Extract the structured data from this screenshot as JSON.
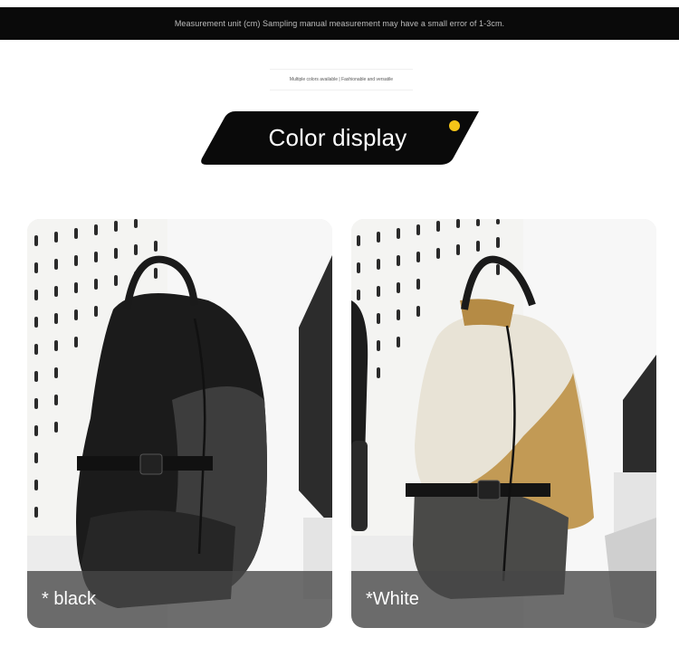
{
  "header": {
    "measurement_note": "Measurement unit (cm) Sampling manual measurement may have a small error of 1-3cm."
  },
  "tagline": "Multiple colors available | Fashionable and versatile",
  "section": {
    "title": "Color display",
    "banner_color": "#0a0a0a",
    "dot_color": "#f5c518"
  },
  "products": [
    {
      "label": "* black",
      "colors": [
        "#1c1c1c",
        "#3a3a3a"
      ]
    },
    {
      "label": "*White",
      "colors": [
        "#e9e4d7",
        "#c29a55"
      ]
    }
  ]
}
